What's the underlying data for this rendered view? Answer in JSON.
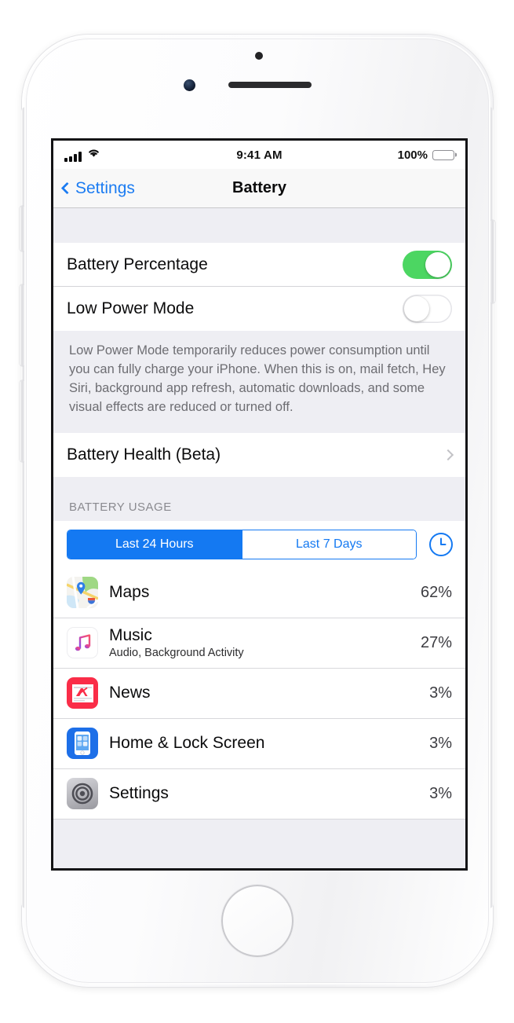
{
  "status_bar": {
    "signal_icon": "cellular-bars-icon",
    "wifi_icon": "wifi-icon",
    "time": "9:41 AM",
    "battery_percent": "100%",
    "battery_icon": "battery-full-icon"
  },
  "nav_bar": {
    "back_icon": "chevron-left-icon",
    "back_label": "Settings",
    "title": "Battery"
  },
  "settings_group": {
    "rows": [
      {
        "label": "Battery Percentage",
        "control": "toggle",
        "state": "on"
      },
      {
        "label": "Low Power Mode",
        "control": "toggle",
        "state": "off"
      }
    ],
    "footer": "Low Power Mode temporarily reduces power consumption until you can fully charge your iPhone. When this is on, mail fetch, Hey Siri, background app refresh, automatic downloads, and some visual effects are reduced or turned off."
  },
  "health_group": {
    "label": "Battery Health (Beta)",
    "disclosure_icon": "chevron-right-icon"
  },
  "usage_section": {
    "header": "BATTERY USAGE",
    "segments": [
      {
        "label": "Last 24 Hours",
        "selected": true
      },
      {
        "label": "Last 7 Days",
        "selected": false
      }
    ],
    "time_toggle_icon": "clock-icon",
    "apps": [
      {
        "name": "Maps",
        "subtitle": "",
        "percent": "62%",
        "icon": "maps-app-icon"
      },
      {
        "name": "Music",
        "subtitle": "Audio, Background Activity",
        "percent": "27%",
        "icon": "music-app-icon"
      },
      {
        "name": "News",
        "subtitle": "",
        "percent": "3%",
        "icon": "news-app-icon"
      },
      {
        "name": "Home & Lock Screen",
        "subtitle": "",
        "percent": "3%",
        "icon": "home-lock-screen-icon"
      },
      {
        "name": "Settings",
        "subtitle": "",
        "percent": "3%",
        "icon": "settings-app-icon"
      }
    ]
  },
  "device": {
    "earpiece_icon": "earpiece-speaker",
    "front_camera_icon": "front-camera",
    "proximity_sensor_icon": "proximity-sensor",
    "home_button_icon": "home-button",
    "silent_switch_icon": "ring-silent-switch",
    "volume_up_icon": "volume-up-button",
    "volume_down_icon": "volume-down-button",
    "power_icon": "power-button"
  },
  "colors": {
    "accent_blue": "#1479f2",
    "toggle_green": "#4cd662",
    "group_bg": "#eeeef3",
    "news_red": "#fa2d48",
    "home_blue": "#1d6fe8"
  }
}
